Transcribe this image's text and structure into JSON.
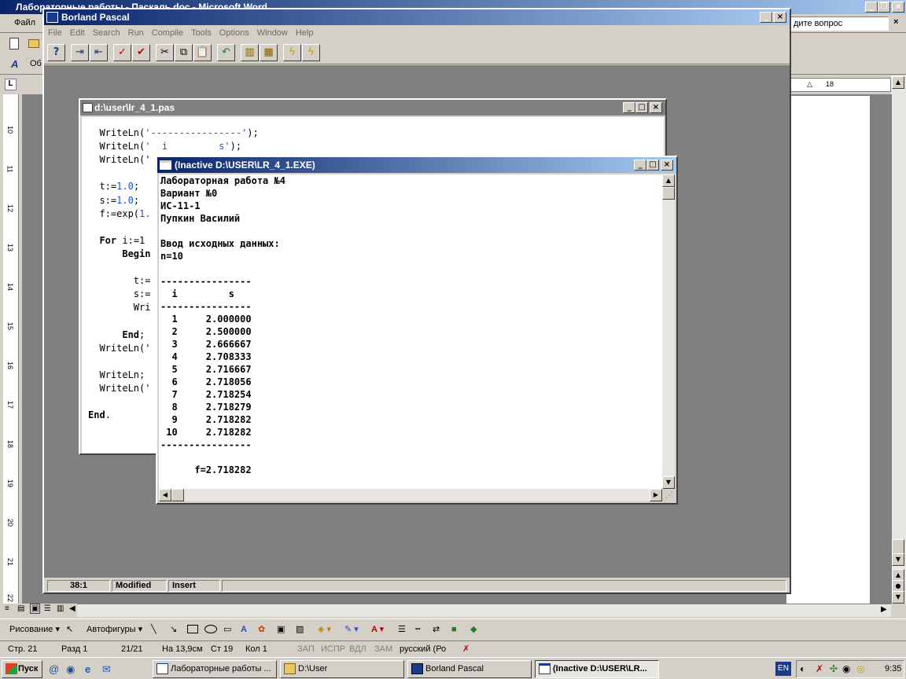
{
  "word": {
    "title": "Лабораторные работы - Паскаль.doc - Microsoft Word",
    "menu_file": "Файл",
    "help_box": "дите вопрос",
    "toolbar_style_text": "Об",
    "ruler_value": "18",
    "vruler_numbers": [
      "10",
      "11",
      "12",
      "13",
      "14",
      "15",
      "16",
      "17",
      "18",
      "19",
      "20",
      "21",
      "22"
    ],
    "drawing_label": "Рисование",
    "autoshapes_label": "Автофигуры",
    "status": {
      "page": "Стр. 21",
      "section": "Разд 1",
      "pages": "21/21",
      "at": "На 13,9см",
      "line": "Ст 19",
      "col": "Кол 1",
      "rec": "ЗАП",
      "trk": "ИСПР",
      "ext": "ВДЛ",
      "ovr": "ЗАМ",
      "lang": "русский (Ро"
    }
  },
  "borland": {
    "title": "Borland Pascal",
    "menu": [
      "File",
      "Edit",
      "Search",
      "Run",
      "Compile",
      "Tools",
      "Options",
      "Window",
      "Help"
    ],
    "status": {
      "position": "38:1",
      "modified": "Modified",
      "mode": "Insert"
    }
  },
  "editor": {
    "title": "d:\\user\\lr_4_1.pas",
    "lines": [
      {
        "indent": "  ",
        "kw": "",
        "text": "WriteLn(",
        "str": "'----------------'",
        "tail": ");"
      },
      {
        "indent": "  ",
        "kw": "",
        "text": "WriteLn(",
        "str": "'  i         s'",
        "tail": ");"
      },
      {
        "indent": "  ",
        "kw": "",
        "text": "WriteLn('",
        "str": "",
        "tail": ""
      },
      {
        "indent": "",
        "kw": "",
        "text": "",
        "str": "",
        "tail": ""
      },
      {
        "indent": "  ",
        "kw": "",
        "text": "t:=",
        "str": "1.0",
        "tail": ";"
      },
      {
        "indent": "  ",
        "kw": "",
        "text": "s:=",
        "str": "1.0",
        "tail": ";"
      },
      {
        "indent": "  ",
        "kw": "",
        "text": "f:=exp(",
        "str": "1.",
        "tail": ""
      },
      {
        "indent": "",
        "kw": "",
        "text": "",
        "str": "",
        "tail": ""
      },
      {
        "indent": "  ",
        "kw": "For",
        "text": " i:=1",
        "str": "",
        "tail": ""
      },
      {
        "indent": "      ",
        "kw": "Begin",
        "text": "",
        "str": "",
        "tail": ""
      },
      {
        "indent": "",
        "kw": "",
        "text": "",
        "str": "",
        "tail": ""
      },
      {
        "indent": "        ",
        "kw": "",
        "text": "t:=",
        "str": "",
        "tail": ""
      },
      {
        "indent": "        ",
        "kw": "",
        "text": "s:=",
        "str": "",
        "tail": ""
      },
      {
        "indent": "        ",
        "kw": "",
        "text": "Wri",
        "str": "",
        "tail": ""
      },
      {
        "indent": "",
        "kw": "",
        "text": "",
        "str": "",
        "tail": ""
      },
      {
        "indent": "      ",
        "kw": "End",
        "text": ";",
        "str": "",
        "tail": ""
      },
      {
        "indent": "  ",
        "kw": "",
        "text": "WriteLn('",
        "str": "",
        "tail": ""
      },
      {
        "indent": "",
        "kw": "",
        "text": "",
        "str": "",
        "tail": ""
      },
      {
        "indent": "  ",
        "kw": "",
        "text": "WriteLn;",
        "str": "",
        "tail": ""
      },
      {
        "indent": "  ",
        "kw": "",
        "text": "WriteLn('",
        "str": "",
        "tail": ""
      },
      {
        "indent": "",
        "kw": "",
        "text": "",
        "str": "",
        "tail": ""
      },
      {
        "indent": "",
        "kw": "End",
        "text": ".",
        "str": "",
        "tail": ""
      }
    ]
  },
  "console": {
    "title": "(Inactive D:\\USER\\LR_4_1.EXE)",
    "lines": [
      "Лабораторная работа №4",
      "Вариант №0",
      "ИС-11-1",
      "Пупкин Василий",
      "",
      "Ввод исходных данных:",
      "n=10",
      "",
      "----------------",
      "  i         s",
      "----------------",
      "  1     2.000000",
      "  2     2.500000",
      "  3     2.666667",
      "  4     2.708333",
      "  5     2.716667",
      "  6     2.718056",
      "  7     2.718254",
      "  8     2.718279",
      "  9     2.718282",
      " 10     2.718282",
      "----------------",
      "",
      "      f=2.718282"
    ]
  },
  "taskbar": {
    "start": "Пуск",
    "buttons": [
      {
        "label": "Лабораторные работы ..."
      },
      {
        "label": "D:\\User"
      },
      {
        "label": "Borland Pascal"
      },
      {
        "label": "(Inactive D:\\USER\\LR..."
      }
    ],
    "lang": "EN",
    "clock": "9:35"
  }
}
